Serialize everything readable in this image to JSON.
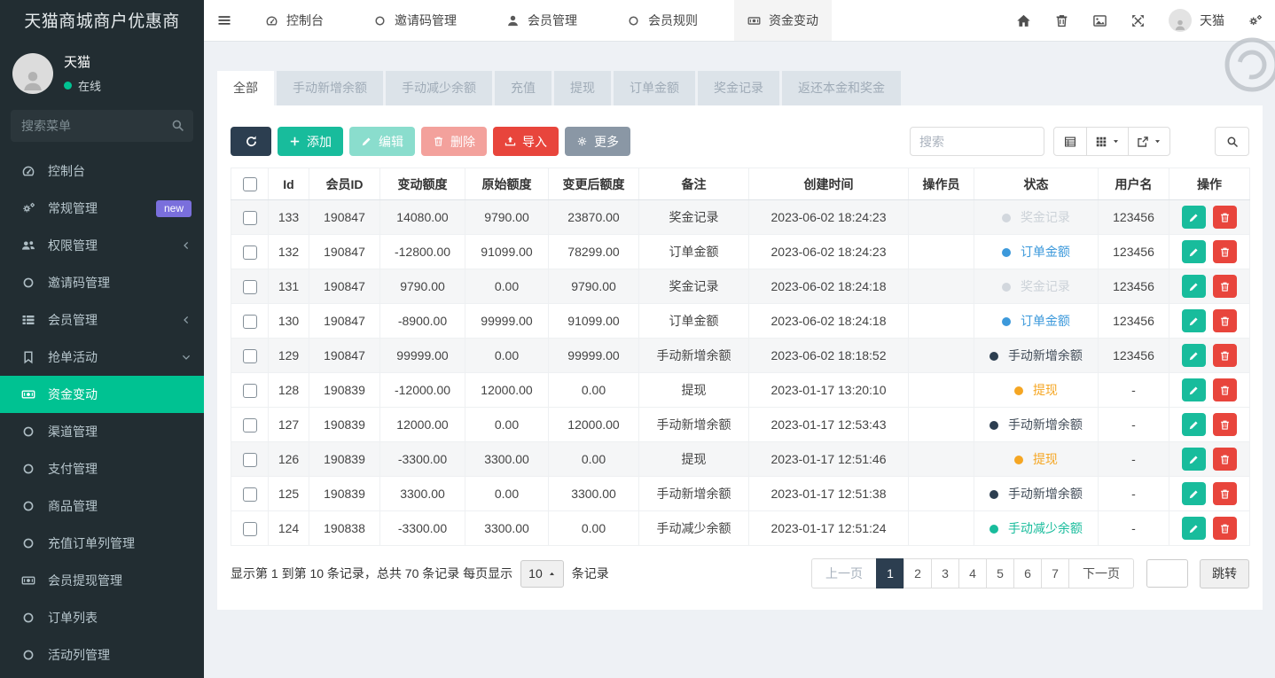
{
  "app": {
    "title": "天猫商城商户优惠商"
  },
  "sidebar": {
    "user": {
      "name": "天猫",
      "status": "在线"
    },
    "search_placeholder": "搜索菜单",
    "items": [
      {
        "key": "dashboard",
        "label": "控制台",
        "icon": "dashboard"
      },
      {
        "key": "general-mgmt",
        "label": "常规管理",
        "icon": "cogs",
        "badge": "new"
      },
      {
        "key": "permission-mgmt",
        "label": "权限管理",
        "icon": "users",
        "chevron": "left"
      },
      {
        "key": "invite-code-mgmt",
        "label": "邀请码管理",
        "icon": "circle"
      },
      {
        "key": "member-mgmt",
        "label": "会员管理",
        "icon": "list",
        "chevron": "left"
      },
      {
        "key": "grab-order-activity",
        "label": "抢单活动",
        "icon": "bookmark",
        "chevron": "down"
      },
      {
        "key": "funds-change",
        "label": "资金变动",
        "icon": "money",
        "active": true
      },
      {
        "key": "channel-mgmt",
        "label": "渠道管理",
        "icon": "circle"
      },
      {
        "key": "payment-mgmt",
        "label": "支付管理",
        "icon": "circle"
      },
      {
        "key": "product-mgmt",
        "label": "商品管理",
        "icon": "circle"
      },
      {
        "key": "recharge-order-mgmt",
        "label": "充值订单列管理",
        "icon": "circle"
      },
      {
        "key": "member-withdraw-mgmt",
        "label": "会员提现管理",
        "icon": "money"
      },
      {
        "key": "order-list",
        "label": "订单列表",
        "icon": "circle"
      },
      {
        "key": "activity-mgmt",
        "label": "活动列管理",
        "icon": "circle"
      }
    ]
  },
  "topnav": {
    "tabs": [
      {
        "key": "dashboard",
        "label": "控制台",
        "icon": "dashboard"
      },
      {
        "key": "invite-code-mgmt",
        "label": "邀请码管理",
        "icon": "circle"
      },
      {
        "key": "member-mgmt",
        "label": "会员管理",
        "icon": "user"
      },
      {
        "key": "member-rules",
        "label": "会员规则",
        "icon": "circle"
      },
      {
        "key": "funds-change",
        "label": "资金变动",
        "icon": "money",
        "active": true
      }
    ],
    "user_name": "天猫"
  },
  "filter_tabs": {
    "items": [
      "全部",
      "手动新增余额",
      "手动减少余额",
      "充值",
      "提现",
      "订单金额",
      "奖金记录",
      "返还本金和奖金"
    ],
    "active_index": 0
  },
  "toolbar": {
    "add_label": "添加",
    "edit_label": "编辑",
    "delete_label": "删除",
    "import_label": "导入",
    "more_label": "更多",
    "search_placeholder": "搜索"
  },
  "table": {
    "columns": [
      "Id",
      "会员ID",
      "变动额度",
      "原始额度",
      "变更后额度",
      "备注",
      "创建时间",
      "操作员",
      "状态",
      "用户名",
      "操作"
    ],
    "rows": [
      {
        "id": "133",
        "member_id": "190847",
        "change": "14080.00",
        "original": "9790.00",
        "after": "23870.00",
        "remark": "奖金记录",
        "created": "2023-06-02 18:24:23",
        "operator": "",
        "status": {
          "label": "奖金记录",
          "dot": "#d2d7dd",
          "text": "#ccd2d8"
        },
        "username": "123456",
        "striped": true
      },
      {
        "id": "132",
        "member_id": "190847",
        "change": "-12800.00",
        "original": "91099.00",
        "after": "78299.00",
        "remark": "订单金额",
        "created": "2023-06-02 18:24:23",
        "operator": "",
        "status": {
          "label": "订单金额",
          "dot": "#3c99db",
          "text": "#3c99db"
        },
        "username": "123456",
        "striped": false
      },
      {
        "id": "131",
        "member_id": "190847",
        "change": "9790.00",
        "original": "0.00",
        "after": "9790.00",
        "remark": "奖金记录",
        "created": "2023-06-02 18:24:18",
        "operator": "",
        "status": {
          "label": "奖金记录",
          "dot": "#d2d7dd",
          "text": "#ccd2d8"
        },
        "username": "123456",
        "striped": true
      },
      {
        "id": "130",
        "member_id": "190847",
        "change": "-8900.00",
        "original": "99999.00",
        "after": "91099.00",
        "remark": "订单金额",
        "created": "2023-06-02 18:24:18",
        "operator": "",
        "status": {
          "label": "订单金额",
          "dot": "#3c99db",
          "text": "#3c99db"
        },
        "username": "123456",
        "striped": false
      },
      {
        "id": "129",
        "member_id": "190847",
        "change": "99999.00",
        "original": "0.00",
        "after": "99999.00",
        "remark": "手动新增余额",
        "created": "2023-06-02 18:18:52",
        "operator": "",
        "status": {
          "label": "手动新增余额",
          "dot": "#2c3e50",
          "text": "#404b57"
        },
        "username": "123456",
        "striped": true
      },
      {
        "id": "128",
        "member_id": "190839",
        "change": "-12000.00",
        "original": "12000.00",
        "after": "0.00",
        "remark": "提现",
        "created": "2023-01-17 13:20:10",
        "operator": "",
        "status": {
          "label": "提现",
          "dot": "#f5a623",
          "text": "#f5a623"
        },
        "username": "-",
        "striped": false
      },
      {
        "id": "127",
        "member_id": "190839",
        "change": "12000.00",
        "original": "0.00",
        "after": "12000.00",
        "remark": "手动新增余额",
        "created": "2023-01-17 12:53:43",
        "operator": "",
        "status": {
          "label": "手动新增余额",
          "dot": "#2c3e50",
          "text": "#404b57"
        },
        "username": "-",
        "striped": false
      },
      {
        "id": "126",
        "member_id": "190839",
        "change": "-3300.00",
        "original": "3300.00",
        "after": "0.00",
        "remark": "提现",
        "created": "2023-01-17 12:51:46",
        "operator": "",
        "status": {
          "label": "提现",
          "dot": "#f5a623",
          "text": "#f5a623"
        },
        "username": "-",
        "striped": true
      },
      {
        "id": "125",
        "member_id": "190839",
        "change": "3300.00",
        "original": "0.00",
        "after": "3300.00",
        "remark": "手动新增余额",
        "created": "2023-01-17 12:51:38",
        "operator": "",
        "status": {
          "label": "手动新增余额",
          "dot": "#2c3e50",
          "text": "#404b57"
        },
        "username": "-",
        "striped": false
      },
      {
        "id": "124",
        "member_id": "190838",
        "change": "-3300.00",
        "original": "3300.00",
        "after": "0.00",
        "remark": "手动减少余额",
        "created": "2023-01-17 12:51:24",
        "operator": "",
        "status": {
          "label": "手动减少余额",
          "dot": "#18bc9c",
          "text": "#18bc9c"
        },
        "username": "-",
        "striped": false
      }
    ]
  },
  "footer": {
    "summary_prefix": "显示第 1 到第 10 条记录，总共 70 条记录 每页显示",
    "per_page": "10",
    "summary_suffix": "条记录",
    "pagination": {
      "prev": "上一页",
      "pages": [
        "1",
        "2",
        "3",
        "4",
        "5",
        "6",
        "7"
      ],
      "active": "1",
      "next": "下一页"
    },
    "jump_label": "跳转"
  },
  "colors": {
    "sidebar_bg": "#222d32",
    "sidebar_active_green": "#00c292",
    "badge_purple": "#7a6fdc",
    "primary_navy": "#2c3e50",
    "success_teal": "#18bc9c",
    "danger_red": "#e8453c",
    "grey_button": "#8a97a5",
    "status_blue": "#3c99db",
    "status_orange": "#f5a623",
    "status_grey": "#ccd2d8",
    "status_dark": "#2c3e50",
    "status_teal": "#18bc9c"
  }
}
